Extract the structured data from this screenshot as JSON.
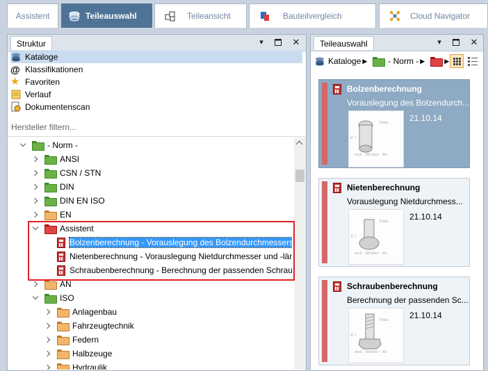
{
  "tabs": [
    {
      "label": "Assistent",
      "icon": "none",
      "active": false
    },
    {
      "label": "Teileauswahl",
      "icon": "parts-stack-icon",
      "active": true
    },
    {
      "label": "Teileansicht",
      "icon": "cubes-icon",
      "active": false
    },
    {
      "label": "Bauteilvergleich",
      "icon": "compare-icon",
      "active": false
    },
    {
      "label": "Cloud Navigator",
      "icon": "network-icon",
      "active": false
    }
  ],
  "left": {
    "title": "Struktur",
    "nav": [
      {
        "label": "Kataloge",
        "icon": "catalog-icon",
        "selected": true
      },
      {
        "label": "Klassifikationen",
        "icon": "at-icon",
        "selected": false
      },
      {
        "label": "Favoriten",
        "icon": "star-icon",
        "selected": false
      },
      {
        "label": "Verlauf",
        "icon": "history-icon",
        "selected": false
      },
      {
        "label": "Dokumentenscan",
        "icon": "document-scan-icon",
        "selected": false
      }
    ],
    "filter_placeholder": "Hersteller filtern...",
    "tree": [
      {
        "label": "- Norm -",
        "level": 0,
        "state": "open",
        "icon": "folder-green"
      },
      {
        "label": "ANSI",
        "level": 1,
        "state": "closed",
        "icon": "folder-green"
      },
      {
        "label": "CSN / STN",
        "level": 1,
        "state": "closed",
        "icon": "folder-green"
      },
      {
        "label": "DIN",
        "level": 1,
        "state": "closed",
        "icon": "folder-green"
      },
      {
        "label": "DIN EN ISO",
        "level": 1,
        "state": "closed",
        "icon": "folder-green"
      },
      {
        "label": "EN",
        "level": 1,
        "state": "closed",
        "icon": "folder-orange"
      },
      {
        "label": "Assistent",
        "level": 1,
        "state": "open",
        "icon": "folder-red"
      },
      {
        "label": "Bolzenberechnung - Vorauslegung des Bolzendurchmessers",
        "level": 2,
        "state": "leaf",
        "icon": "calculator",
        "selected": true
      },
      {
        "label": "Nietenberechnung - Vorauslegung Nietdurchmesser und -länge",
        "level": 2,
        "state": "leaf",
        "icon": "calculator"
      },
      {
        "label": "Schraubenberechnung - Berechnung der passenden Schraube",
        "level": 2,
        "state": "leaf",
        "icon": "calculator"
      },
      {
        "label": "AN",
        "level": 1,
        "state": "closed",
        "icon": "folder-orange"
      },
      {
        "label": "ISO",
        "level": 1,
        "state": "open",
        "icon": "folder-green"
      },
      {
        "label": "Anlagenbau",
        "level": 2,
        "state": "closed",
        "icon": "folder-orange"
      },
      {
        "label": "Fahrzeugtechnik",
        "level": 2,
        "state": "closed",
        "icon": "folder-orange"
      },
      {
        "label": "Federn",
        "level": 2,
        "state": "closed",
        "icon": "folder-orange"
      },
      {
        "label": "Halbzeuge",
        "level": 2,
        "state": "closed",
        "icon": "folder-orange"
      },
      {
        "label": "Hydraulik",
        "level": 2,
        "state": "closed",
        "icon": "folder-orange"
      }
    ]
  },
  "right": {
    "title": "Teileauswahl",
    "breadcrumb": [
      "Kataloge",
      "- Norm -"
    ],
    "cards": [
      {
        "title": "Bolzenberechnung",
        "subtitle": "Vorauslegung des Bolzendurch...",
        "date": "21.10.14",
        "selected": true
      },
      {
        "title": "Nietenberechnung",
        "subtitle": "Vorauslegung Nietdurchmess...",
        "date": "21.10.14",
        "selected": false
      },
      {
        "title": "Schraubenberechnung",
        "subtitle": "Berechnung der passenden Sc...",
        "date": "21.10.14",
        "selected": false
      }
    ],
    "formula_text": [
      "d =",
      "Fmin",
      "σzul · BFaktor · Re"
    ]
  },
  "colors": {
    "accent": "#4f7396",
    "selection": "#3399ff",
    "highlight_box": "#e02020"
  }
}
